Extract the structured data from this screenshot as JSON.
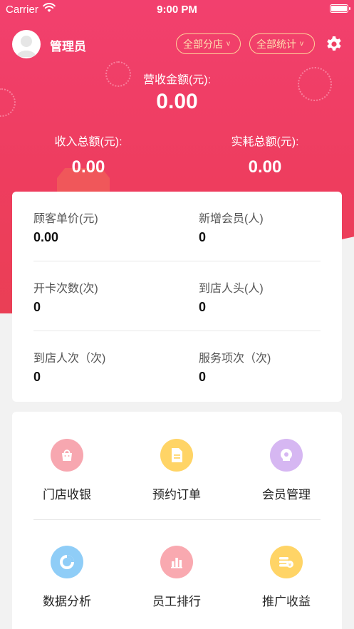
{
  "status_bar": {
    "carrier": "Carrier",
    "time": "9:00 PM"
  },
  "header": {
    "user_name": "管理员",
    "store_filter": "全部分店",
    "stat_filter": "全部统计",
    "dropdown_glyph": "v"
  },
  "summary": {
    "revenue_label": "营收金额(元):",
    "revenue_value": "0.00",
    "income_label": "收入总额(元):",
    "income_value": "0.00",
    "consumption_label": "实耗总额(元):",
    "consumption_value": "0.00"
  },
  "stats": [
    {
      "label": "顾客单价(元)",
      "value": "0.00"
    },
    {
      "label": "新增会员(人)",
      "value": "0"
    },
    {
      "label": "开卡次数(次)",
      "value": "0"
    },
    {
      "label": "到店人头(人)",
      "value": "0"
    },
    {
      "label": "到店人次（次)",
      "value": "0"
    },
    {
      "label": "服务项次（次)",
      "value": "0"
    }
  ],
  "menu": [
    {
      "label": "门店收银",
      "icon": "shopping-bag-icon",
      "color": "#f7a7b0"
    },
    {
      "label": "预约订单",
      "icon": "document-icon",
      "color": "#ffd466"
    },
    {
      "label": "会员管理",
      "icon": "member-icon",
      "color": "#d6b7f2"
    },
    {
      "label": "数据分析",
      "icon": "pie-chart-icon",
      "color": "#8fcdf7"
    },
    {
      "label": "员工排行",
      "icon": "bar-chart-icon",
      "color": "#f9a9b0"
    },
    {
      "label": "推广收益",
      "icon": "coins-icon",
      "color": "#ffd466"
    }
  ],
  "colors": {
    "accent": "#ef3f62",
    "filter_border": "#ffd29a"
  }
}
